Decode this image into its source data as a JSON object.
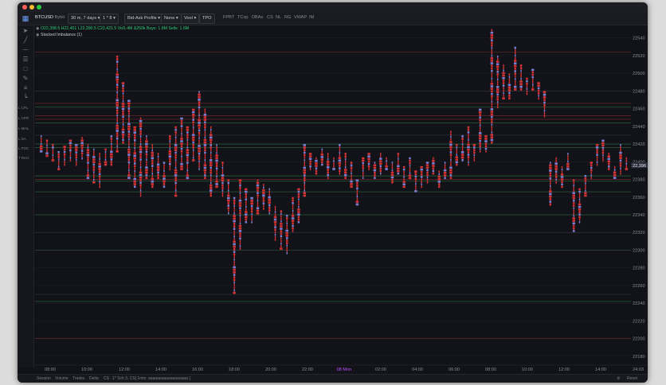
{
  "toolbar": {
    "symbol": "BTCUSD",
    "exchange": "Bybit",
    "timeframe": "30 m, 7 days",
    "multiplier": "1 * 8",
    "profile": "Bid-Ask Profile",
    "overlay": "None",
    "mode": "Vool",
    "tpo": "TPO",
    "indicators": [
      "FPBT",
      "TCvp",
      "DBAs",
      "CS",
      "NL",
      "RG",
      "VWAP",
      "IM"
    ]
  },
  "legend": {
    "ohlc": "O22,398.5 H22,451 L22,390.5 C22,421.5",
    "volume": "Vol1.4M Δ250k",
    "buys": "Buys: 1.8M",
    "sells": "Sells: 1.6M",
    "study": "Stacked Imbalance (1)"
  },
  "left_tools": {
    "labels": [
      "L CPL",
      "L CPR",
      "L MHL",
      "L SA",
      "L POC",
      "T Rect"
    ]
  },
  "chart_data": {
    "type": "footprint",
    "y_ticks": [
      22540,
      22520,
      22500,
      22480,
      22460,
      22440,
      22420,
      22400,
      22380,
      22360,
      22340,
      22320,
      22300,
      22280,
      22260,
      22240,
      22220,
      22200,
      22180
    ],
    "ylim": [
      22170,
      22555
    ],
    "price_label": "22,396",
    "x_labels": [
      "08:00",
      "10:00",
      "12:00",
      "14:00",
      "16:00",
      "18:00",
      "20:00",
      "22:00",
      "08 Mon",
      "02:00",
      "04:00",
      "06:00",
      "08:00",
      "10:00",
      "12:00",
      "14:00"
    ],
    "highlight_label": "08 Mon",
    "last_x_label": "24:03",
    "candles": [
      [
        22430,
        22410
      ],
      [
        22425,
        22405
      ],
      [
        22420,
        22400
      ],
      [
        22412,
        22390
      ],
      [
        22418,
        22395
      ],
      [
        22425,
        22400
      ],
      [
        22420,
        22395
      ],
      [
        22428,
        22402
      ],
      [
        22420,
        22380
      ],
      [
        22415,
        22375
      ],
      [
        22410,
        22370
      ],
      [
        22415,
        22395
      ],
      [
        22430,
        22395
      ],
      [
        22520,
        22410
      ],
      [
        22490,
        22420
      ],
      [
        22470,
        22380
      ],
      [
        22440,
        22370
      ],
      [
        22450,
        22360
      ],
      [
        22430,
        22380
      ],
      [
        22420,
        22370
      ],
      [
        22410,
        22380
      ],
      [
        22400,
        22370
      ],
      [
        22430,
        22390
      ],
      [
        22440,
        22360
      ],
      [
        22450,
        22390
      ],
      [
        22440,
        22380
      ],
      [
        22460,
        22400
      ],
      [
        22480,
        22390
      ],
      [
        22460,
        22380
      ],
      [
        22440,
        22360
      ],
      [
        22420,
        22370
      ],
      [
        22400,
        22360
      ],
      [
        22380,
        22340
      ],
      [
        22360,
        22250
      ],
      [
        22380,
        22300
      ],
      [
        22370,
        22330
      ],
      [
        22360,
        22330
      ],
      [
        22380,
        22340
      ],
      [
        22375,
        22345
      ],
      [
        22370,
        22340
      ],
      [
        22350,
        22310
      ],
      [
        22345,
        22300
      ],
      [
        22340,
        22295
      ],
      [
        22360,
        22320
      ],
      [
        22370,
        22330
      ],
      [
        22420,
        22360
      ],
      [
        22410,
        22390
      ],
      [
        22405,
        22385
      ],
      [
        22415,
        22395
      ],
      [
        22410,
        22380
      ],
      [
        22405,
        22390
      ],
      [
        22420,
        22385
      ],
      [
        22410,
        22380
      ],
      [
        22400,
        22370
      ],
      [
        22380,
        22350
      ],
      [
        22405,
        22380
      ],
      [
        22410,
        22390
      ],
      [
        22400,
        22380
      ],
      [
        22410,
        22385
      ],
      [
        22405,
        22390
      ],
      [
        22400,
        22375
      ],
      [
        22410,
        22385
      ],
      [
        22395,
        22370
      ],
      [
        22405,
        22380
      ],
      [
        22390,
        22365
      ],
      [
        22395,
        22370
      ],
      [
        22400,
        22375
      ],
      [
        22405,
        22385
      ],
      [
        22390,
        22370
      ],
      [
        22400,
        22380
      ],
      [
        22435,
        22380
      ],
      [
        22420,
        22395
      ],
      [
        22430,
        22400
      ],
      [
        22440,
        22395
      ],
      [
        22420,
        22400
      ],
      [
        22460,
        22410
      ],
      [
        22430,
        22410
      ],
      [
        22550,
        22420
      ],
      [
        22520,
        22460
      ],
      [
        22510,
        22470
      ],
      [
        22500,
        22470
      ],
      [
        22530,
        22480
      ],
      [
        22510,
        22480
      ],
      [
        22495,
        22475
      ],
      [
        22505,
        22480
      ],
      [
        22490,
        22470
      ],
      [
        22480,
        22450
      ],
      [
        22400,
        22350
      ],
      [
        22405,
        22375
      ],
      [
        22395,
        22370
      ],
      [
        22410,
        22390
      ],
      [
        22380,
        22320
      ],
      [
        22370,
        22330
      ],
      [
        22385,
        22360
      ],
      [
        22400,
        22380
      ],
      [
        22420,
        22395
      ],
      [
        22425,
        22400
      ],
      [
        22410,
        22390
      ],
      [
        22395,
        22380
      ],
      [
        22420,
        22385
      ],
      [
        22405,
        22390
      ]
    ],
    "levels": [
      {
        "price": 22524,
        "color": "#6a2a2a"
      },
      {
        "price": 22480,
        "color": "#2f3340"
      },
      {
        "price": 22466,
        "color": "#7a2a2a"
      },
      {
        "price": 22462,
        "color": "#2a5a3a"
      },
      {
        "price": 22452,
        "color": "#702828"
      },
      {
        "price": 22448,
        "color": "#7a2a2a"
      },
      {
        "price": 22444,
        "color": "#2a5a3a"
      },
      {
        "price": 22430,
        "color": "#2f3340"
      },
      {
        "price": 22420,
        "color": "#2a6a3a"
      },
      {
        "price": 22416,
        "color": "#2a5a3a"
      },
      {
        "price": 22384,
        "color": "#2a6a3a"
      },
      {
        "price": 22380,
        "color": "#7a2a2a"
      },
      {
        "price": 22378,
        "color": "#2a5a3a"
      },
      {
        "price": 22366,
        "color": "#2a5a3a"
      },
      {
        "price": 22340,
        "color": "#2a5a3a"
      },
      {
        "price": 22320,
        "color": "#2f3340"
      },
      {
        "price": 22300,
        "color": "#2a4a3a"
      },
      {
        "price": 22250,
        "color": "#2f3340"
      },
      {
        "price": 22242,
        "color": "#2a6a3a"
      },
      {
        "price": 22200,
        "color": "#5a2a2a"
      }
    ],
    "colors": {
      "bid": "#e03535",
      "ask": "#7e86e0",
      "wick": "#7a2a2a",
      "grid": "#1d1e26",
      "axis_text": "#8b8c95"
    }
  },
  "status_bar": {
    "items": [
      "Session",
      "Volume",
      "Trades",
      "Delta",
      "CS",
      "1* Sch 3, CS[ 1min: aaaaaaaaaaaaaaaaaa ]"
    ],
    "right": [
      "Reset"
    ]
  }
}
